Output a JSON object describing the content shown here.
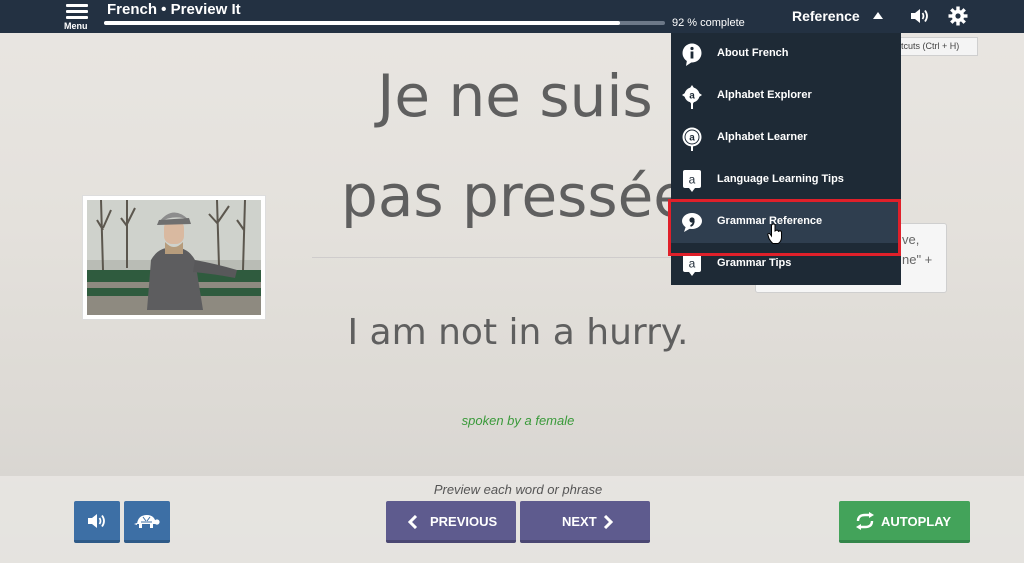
{
  "header": {
    "menu_label": "Menu",
    "title": "French • Preview It",
    "progress_percent": 92,
    "progress_text": "92 % complete",
    "reference_label": "Reference"
  },
  "reference_menu": {
    "items": [
      {
        "label": "About French",
        "icon": "info-icon"
      },
      {
        "label": "Alphabet Explorer",
        "icon": "alphabet-explorer-icon"
      },
      {
        "label": "Alphabet Learner",
        "icon": "alphabet-learner-icon"
      },
      {
        "label": "Language Learning Tips",
        "icon": "letter-a-icon"
      },
      {
        "label": "Grammar Reference",
        "icon": "comma-icon"
      },
      {
        "label": "Grammar Tips",
        "icon": "letter-a-icon"
      }
    ],
    "active_item": "Grammar Reference"
  },
  "shortcut_tip": "rtcuts  (Ctrl + H)",
  "hint_fragment": [
    "ve,",
    "ne\" +"
  ],
  "main": {
    "phrase_line1": "Je ne suis",
    "phrase_line2": "pas pressée",
    "translation": "I am not in a hurry.",
    "speaker": "spoken by a female"
  },
  "footer": {
    "instruction": "Preview each word or phrase",
    "previous_label": "PREVIOUS",
    "next_label": "NEXT",
    "autoplay_label": "AUTOPLAY"
  },
  "colors": {
    "topbar": "#233142",
    "nav_button": "#5e5b8e",
    "audio_button": "#3d6fa5",
    "autoplay_button": "#43a35a",
    "speaker_text": "#3a9a3a",
    "highlight": "#e0202a"
  }
}
